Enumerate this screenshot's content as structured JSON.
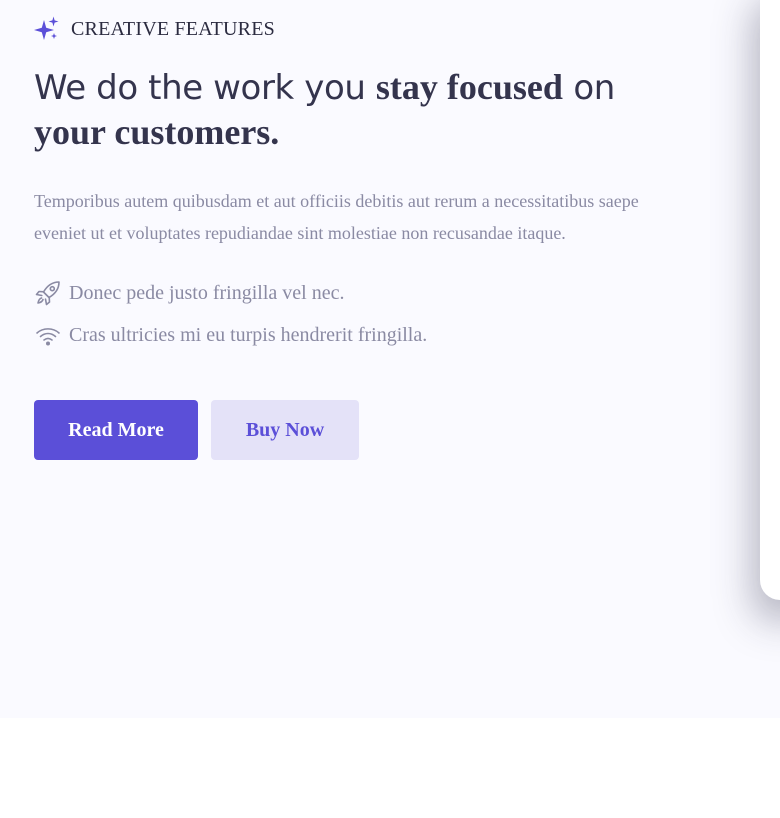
{
  "colors": {
    "accent": "#5b4fd8",
    "accent_soft": "#e4e2f8",
    "heading": "#34344d",
    "muted_text": "#8a8aa3",
    "section_bg": "#fafaff"
  },
  "eyebrow": {
    "icon": "sparkles-icon",
    "label": "CREATIVE FEATURES"
  },
  "headline": {
    "part1": "We do the work you ",
    "part2": "stay focused",
    "part3": " on",
    "part4": "your customers."
  },
  "description": "Temporibus autem quibusdam et aut officiis debitis aut rerum a necessitatibus saepe eveniet ut et voluptates repudiandae sint molestiae non recusandae itaque.",
  "features": [
    {
      "icon": "rocket-icon",
      "text": "Donec pede justo fringilla vel nec."
    },
    {
      "icon": "wifi-icon",
      "text": "Cras ultricies mi eu turpis hendrerit fringilla."
    }
  ],
  "buttons": {
    "primary": "Read More",
    "secondary": "Buy Now"
  }
}
